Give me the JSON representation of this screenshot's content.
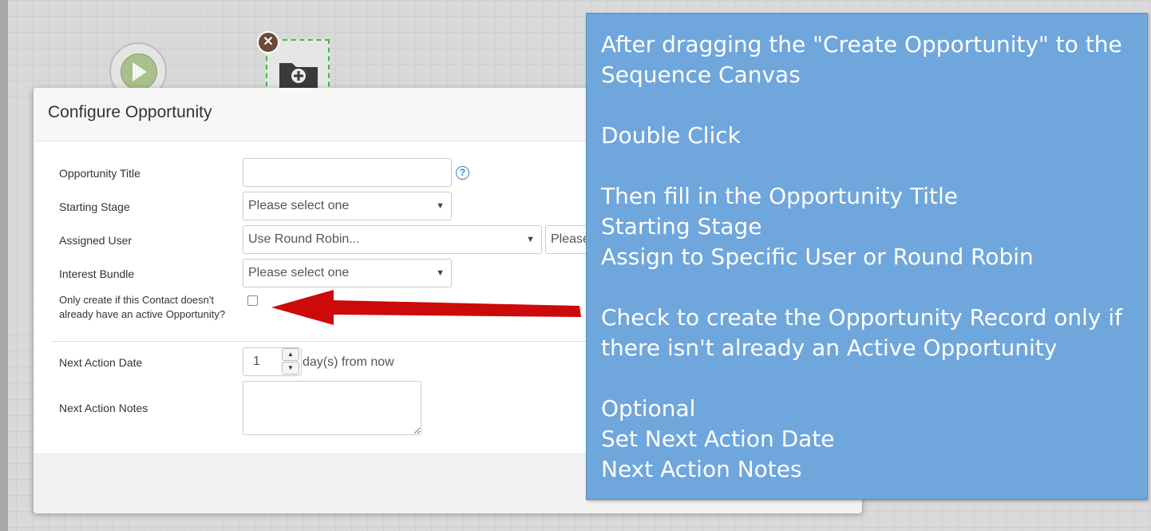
{
  "canvas": {
    "start_icon": "play-icon",
    "folder_icon": "folder-add-icon",
    "remove_icon": "close-icon",
    "remove_glyph": "✕"
  },
  "modal": {
    "title": "Configure Opportunity",
    "fields": {
      "opportunity_title": {
        "label": "Opportunity Title",
        "value": ""
      },
      "starting_stage": {
        "label": "Starting Stage",
        "value": "Please select one"
      },
      "assigned_user": {
        "label": "Assigned User",
        "value": "Use Round Robin...",
        "secondary_value": "Please"
      },
      "interest_bundle": {
        "label": "Interest Bundle",
        "value": "Please select one"
      },
      "only_create": {
        "label": "Only create if this Contact doesn't already have an active Opportunity?",
        "checked": false
      },
      "next_action_date": {
        "label": "Next Action Date",
        "value": "1",
        "suffix": "day(s) from now"
      },
      "next_action_notes": {
        "label": "Next Action Notes",
        "value": ""
      }
    },
    "help_glyph": "?",
    "caret_glyph": "▼",
    "spin_up_glyph": "▲",
    "spin_down_glyph": "▼"
  },
  "callout": {
    "lines": [
      "After dragging the \"Create Opportunity\" to the Sequence Canvas",
      "",
      "Double Click",
      "",
      "Then fill in the Opportunity Title",
      "Starting Stage",
      "Assign to Specific User or Round Robin",
      "",
      "Check to create the Opportunity Record only if there isn't already an Active Opportunity",
      "",
      "Optional",
      "Set Next Action Date",
      "Next Action Notes"
    ]
  },
  "colors": {
    "callout_bg": "#6fa6dc",
    "arrow": "#cc0a0a",
    "selection_dash": "#3bbf3b",
    "help_blue": "#2f84c6"
  }
}
